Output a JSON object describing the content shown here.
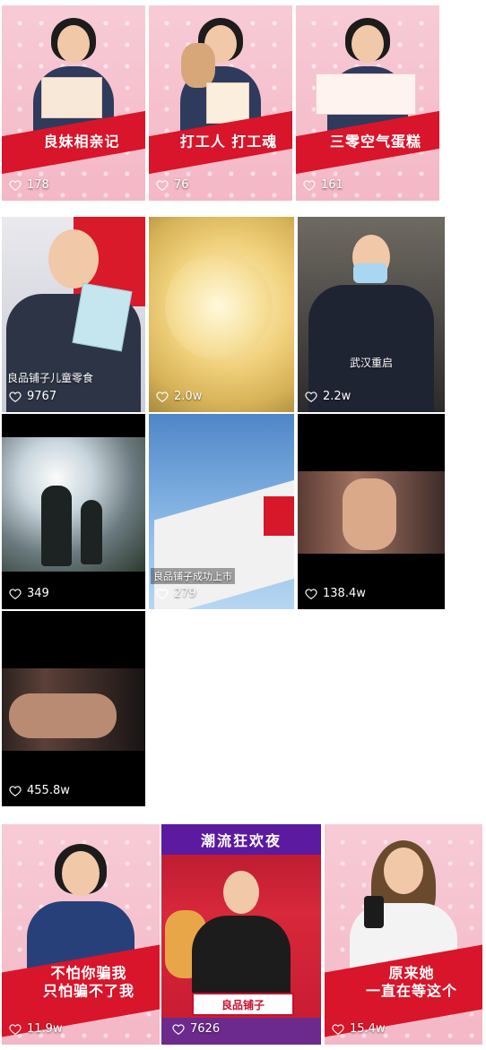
{
  "rows": [
    [
      {
        "title": "良妹相亲记",
        "likes": "178"
      },
      {
        "title": "打工人 打工魂",
        "likes": "76"
      },
      {
        "title": "三零空气蛋糕",
        "likes": "161"
      }
    ],
    [
      {
        "overlay": "良品铺子儿童零食",
        "likes": "9767"
      },
      {
        "likes": "2.0w"
      },
      {
        "overlay": "武汉重启",
        "likes": "2.2w"
      }
    ],
    [
      {
        "likes": "349"
      },
      {
        "overlay": "良品铺子成功上市",
        "likes": "279"
      },
      {
        "likes": "138.4w"
      }
    ],
    [
      {
        "likes": "455.8w"
      }
    ],
    [
      {
        "title1": "不怕你骗我",
        "title2": "只怕骗不了我",
        "likes": "11.9w"
      },
      {
        "banner": "潮流狂欢夜",
        "sign": "良品铺子",
        "likes": "7626"
      },
      {
        "title1": "原来她",
        "title2": "一直在等这个",
        "likes": "15.4w"
      }
    ]
  ],
  "icons": {
    "like": "heart-outline-icon"
  }
}
